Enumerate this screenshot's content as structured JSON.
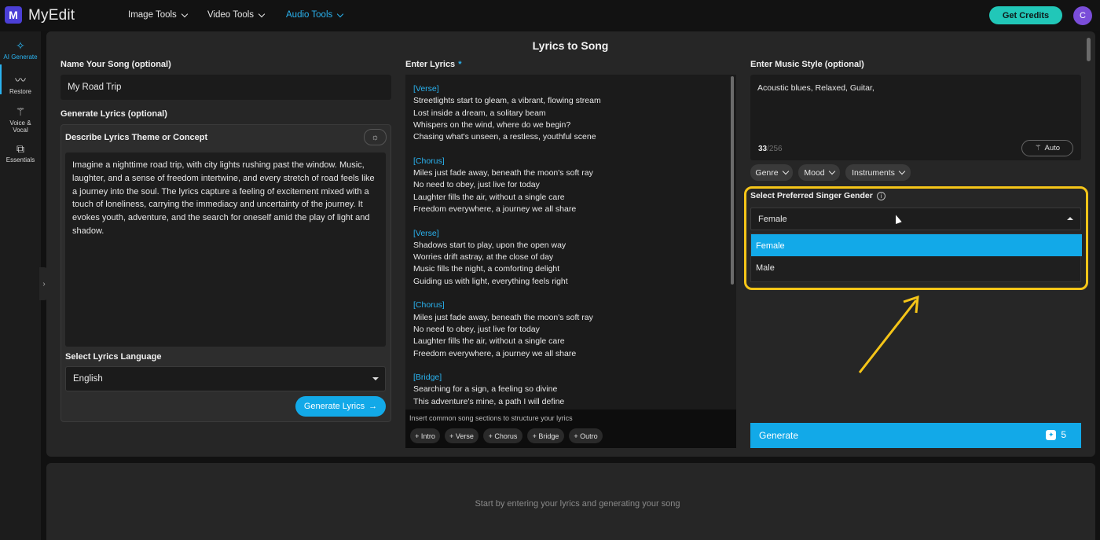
{
  "app": {
    "logo_letter": "M",
    "name": "MyEdit",
    "avatar_letter": "C",
    "credits_label": "Get Credits"
  },
  "nav": {
    "items": [
      {
        "label": "Image Tools"
      },
      {
        "label": "Video Tools"
      },
      {
        "label": "Audio Tools"
      }
    ]
  },
  "sidebar": {
    "items": [
      {
        "label": "AI Generate"
      },
      {
        "label": "Restore"
      },
      {
        "label": "Voice & Vocal"
      },
      {
        "label": "Essentials"
      }
    ]
  },
  "page": {
    "title": "Lyrics to Song"
  },
  "song": {
    "name_label": "Name Your Song (optional)",
    "name_value": "My Road Trip",
    "generate_lyrics_label": "Generate Lyrics (optional)",
    "theme_label": "Describe Lyrics Theme or Concept",
    "theme_text": "Imagine a nighttime road trip, with city lights rushing past the window. Music, laughter, and a sense of freedom intertwine, and every stretch of road feels like a journey into the soul. The lyrics capture a feeling of excitement mixed with a touch of loneliness, carrying the immediacy and uncertainty of the journey. It evokes youth, adventure, and the search for oneself amid the play of light and shadow.",
    "language_label": "Select Lyrics Language",
    "language_value": "English",
    "generate_lyrics_button": "Generate Lyrics"
  },
  "lyrics": {
    "label": "Enter Lyrics",
    "required_mark": "*",
    "lines": [
      {
        "text": "[Verse]",
        "section": true
      },
      {
        "text": "Streetlights start to gleam, a vibrant, flowing stream"
      },
      {
        "text": "Lost inside a dream, a solitary beam"
      },
      {
        "text": "Whispers on the wind, where do we begin?"
      },
      {
        "text": "Chasing what's unseen, a restless, youthful scene"
      },
      {
        "text": "",
        "gap": true
      },
      {
        "text": "[Chorus]",
        "section": true
      },
      {
        "text": "Miles just fade away, beneath the moon's soft ray"
      },
      {
        "text": "No need to obey, just live for today"
      },
      {
        "text": "Laughter fills the air, without a single care"
      },
      {
        "text": "Freedom everywhere, a journey we all share"
      },
      {
        "text": "",
        "gap": true
      },
      {
        "text": "[Verse]",
        "section": true
      },
      {
        "text": "Shadows start to play, upon the open way"
      },
      {
        "text": "Worries drift astray, at the close of day"
      },
      {
        "text": "Music fills the night, a comforting delight"
      },
      {
        "text": "Guiding us with light, everything feels right"
      },
      {
        "text": "",
        "gap": true
      },
      {
        "text": "[Chorus]",
        "section": true
      },
      {
        "text": "Miles just fade away, beneath the moon's soft ray"
      },
      {
        "text": "No need to obey, just live for today"
      },
      {
        "text": "Laughter fills the air, without a single care"
      },
      {
        "text": "Freedom everywhere, a journey we all share"
      },
      {
        "text": "",
        "gap": true
      },
      {
        "text": "[Bridge]",
        "section": true
      },
      {
        "text": "Searching for a sign, a feeling so divine"
      },
      {
        "text": "This adventure's mine, a path I will define"
      }
    ],
    "sections_hint": "Insert common song sections to structure your lyrics",
    "section_chips": [
      "+ Intro",
      "+ Verse",
      "+ Chorus",
      "+ Bridge",
      "+ Outro"
    ]
  },
  "style": {
    "label": "Enter Music Style (optional)",
    "value": "Acoustic blues, Relaxed, Guitar,",
    "count": "33",
    "max": "/256",
    "auto_label": "Auto",
    "tags": [
      "Genre",
      "Mood",
      "Instruments"
    ]
  },
  "gender": {
    "label": "Select Preferred Singer Gender",
    "info_glyph": "i",
    "selected": "Female",
    "options": [
      "Female",
      "Male"
    ]
  },
  "generate": {
    "label": "Generate",
    "credit_cost": "5"
  },
  "results": {
    "empty_hint": "Start by entering your lyrics and generating your song"
  },
  "colors": {
    "accent": "#12a9e8",
    "credits": "#21c7b8",
    "highlight": "#f5c518",
    "brand": "#4b3fd6"
  }
}
